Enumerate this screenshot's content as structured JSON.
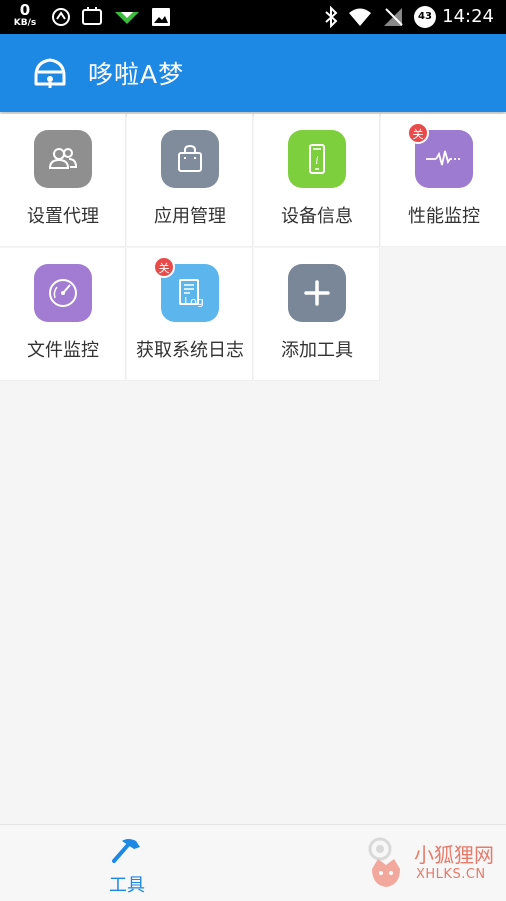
{
  "status_bar": {
    "net_speed_value": "0",
    "net_speed_unit": "KB/s",
    "battery": "43",
    "time": "14:24"
  },
  "app_bar": {
    "title": "哆啦A梦"
  },
  "tools": [
    {
      "label": "设置代理",
      "icon": "users-icon",
      "color": "#8f8f8f",
      "badge": ""
    },
    {
      "label": "应用管理",
      "icon": "shopping-bag-icon",
      "color": "#808b9b",
      "badge": ""
    },
    {
      "label": "设备信息",
      "icon": "phone-info-icon",
      "color": "#7dcf3e",
      "badge": ""
    },
    {
      "label": "性能监控",
      "icon": "pulse-icon",
      "color": "#9d7bd0",
      "badge": "关"
    },
    {
      "label": "文件监控",
      "icon": "radar-icon",
      "color": "#a27bd2",
      "badge": ""
    },
    {
      "label": "获取系统日志",
      "icon": "log-icon",
      "color": "#5db5ee",
      "badge": "关"
    },
    {
      "label": "添加工具",
      "icon": "plus-icon",
      "color": "#7a8798",
      "badge": ""
    }
  ],
  "bottom_nav": {
    "tools_label": "工具",
    "accent": "#1e88e5"
  },
  "watermark": {
    "title": "小狐狸网",
    "url": "XHLKS.CN"
  }
}
